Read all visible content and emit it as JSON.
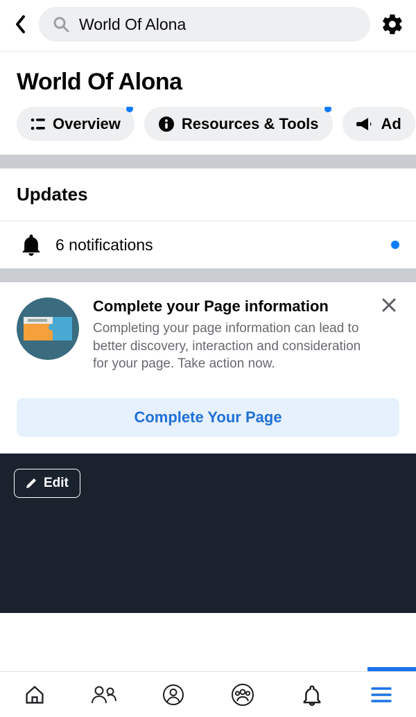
{
  "header": {
    "search_value": "World Of Alona"
  },
  "page": {
    "title": "World Of Alona"
  },
  "tabs": [
    {
      "label": "Overview",
      "icon": "list",
      "badge": true
    },
    {
      "label": "Resources & Tools",
      "icon": "info",
      "badge": true
    },
    {
      "label": "Ad",
      "icon": "bullhorn",
      "badge": false
    }
  ],
  "updates": {
    "heading": "Updates",
    "notifications_label": "6 notifications"
  },
  "promo": {
    "title": "Complete your Page information",
    "desc": "Completing your page information can lead to better discovery, interaction and consideration for your page. Take action now.",
    "cta": "Complete Your Page"
  },
  "cover": {
    "edit_label": "Edit"
  }
}
